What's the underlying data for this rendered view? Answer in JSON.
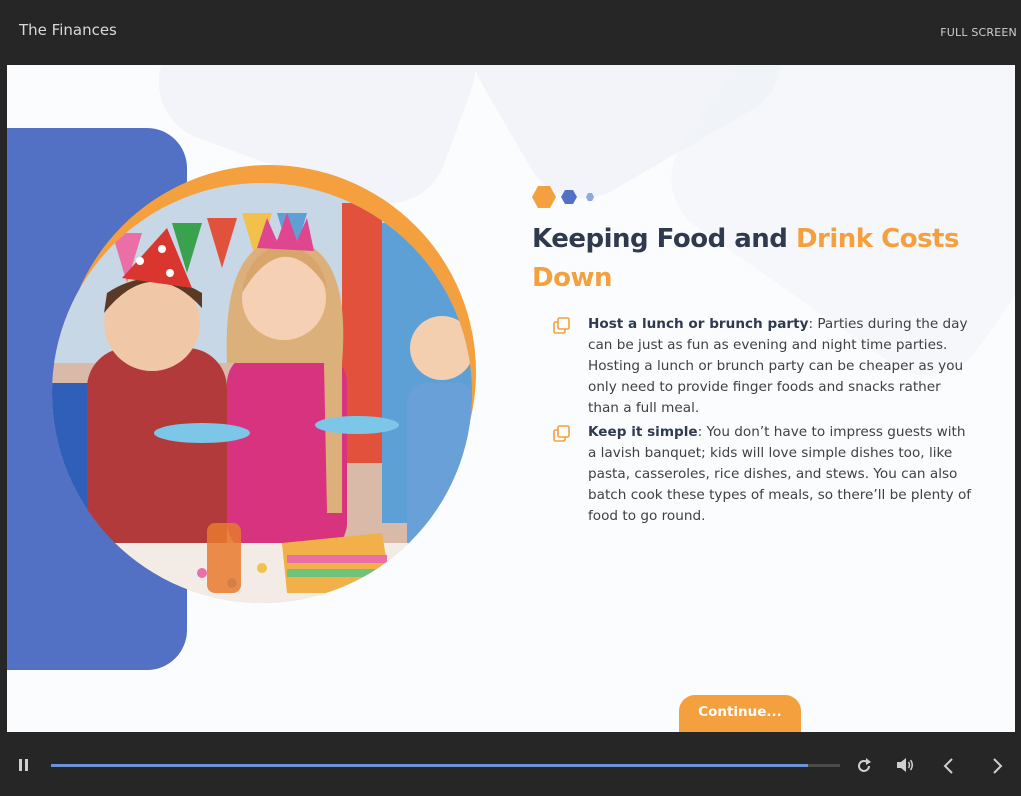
{
  "player": {
    "course_title": "The Finances",
    "fullscreen_label": "FULL SCREEN",
    "progress": 0.96
  },
  "slide": {
    "heading_part1": "Keeping Food and ",
    "heading_accent": "Drink Costs Down",
    "bullets": [
      {
        "title": "Host a lunch or brunch party",
        "text": ": Parties during the day can be just as fun as evening and night time parties. Hosting a lunch or brunch party can be cheaper as you only need to provide finger foods and snacks rather than a full meal."
      },
      {
        "title": "Keep it simple",
        "text": ": You don’t have to impress guests with a lavish banquet; kids will love simple dishes too, like pasta, casseroles, rice dishes, and stews. You can also batch cook these types of meals, so there’ll be plenty of food to go round."
      }
    ],
    "continue_label": "Continue..."
  },
  "colors": {
    "accent": "#f4a03e",
    "brand_blue": "#5271c4",
    "heading": "#2f3a4f",
    "progress": "#6c93d8"
  },
  "icons": {
    "bullet": "copy-squares-icon",
    "pause": "pause-icon",
    "replay": "replay-icon",
    "volume": "volume-icon",
    "prev": "chevron-left-icon",
    "next": "chevron-right-icon"
  }
}
